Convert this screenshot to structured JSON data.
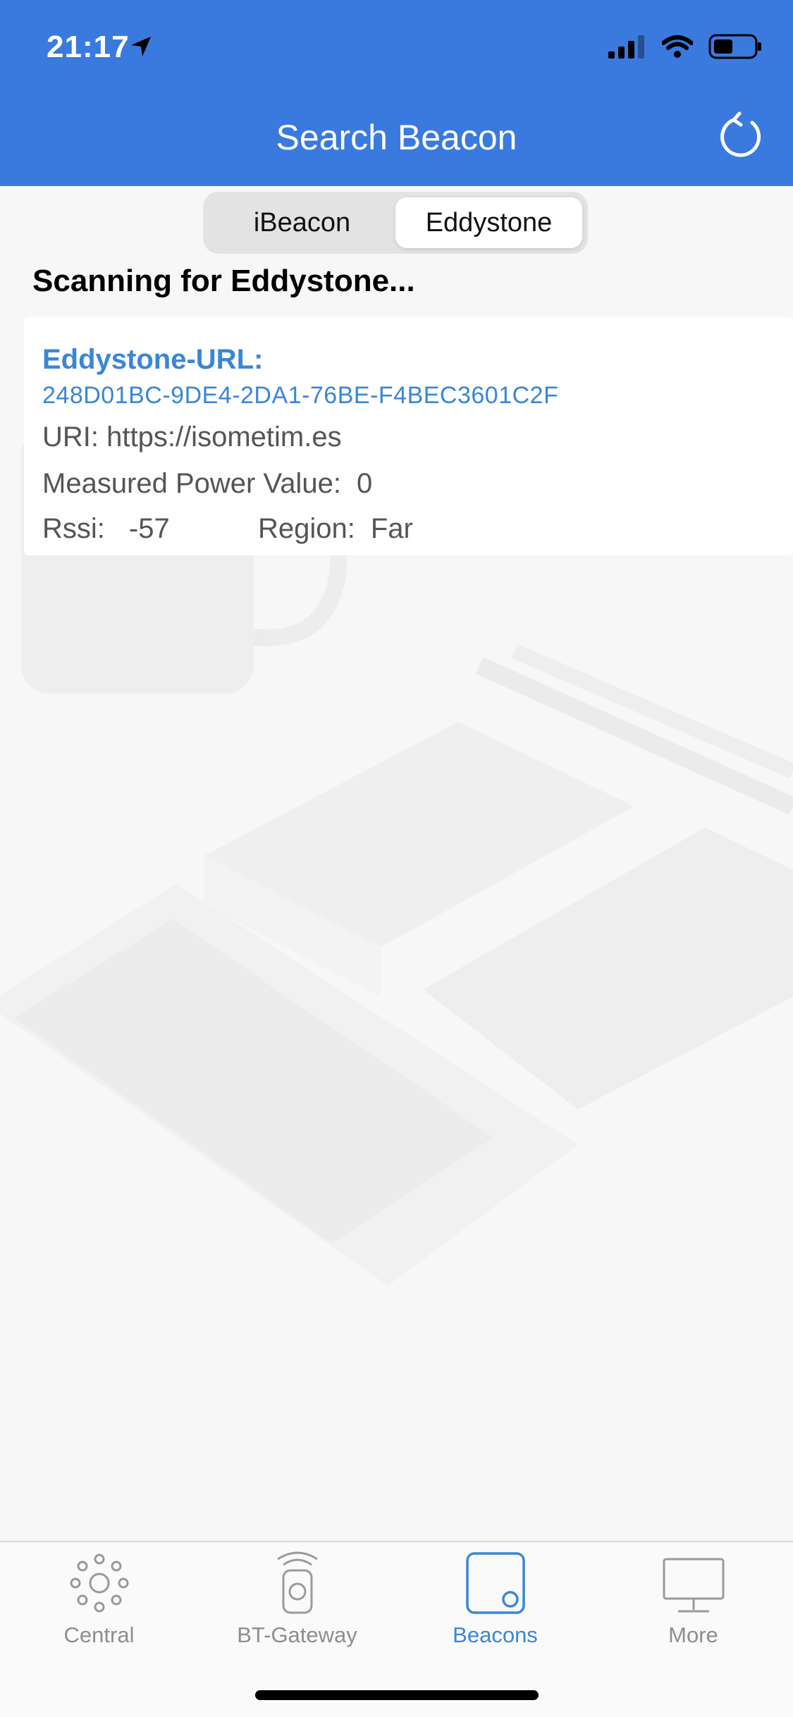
{
  "status_bar": {
    "time": "21:17"
  },
  "nav": {
    "title": "Search Beacon",
    "refresh_icon": "refresh-icon"
  },
  "segments": [
    {
      "label": "iBeacon",
      "active": false
    },
    {
      "label": "Eddystone",
      "active": true
    }
  ],
  "scan_status": "Scanning for Eddystone...",
  "beacon": {
    "type": "Eddystone-URL:",
    "uuid": "248D01BC-9DE4-2DA1-76BE-F4BEC3601C2F",
    "uri_label": "URI:",
    "uri_value": "https://isometim.es",
    "power_label": "Measured Power Value:",
    "power_value": "0",
    "rssi_label": "Rssi:",
    "rssi_value": "-57",
    "region_label": "Region:",
    "region_value": "Far"
  },
  "tabs": [
    {
      "label": "Central",
      "icon": "central-icon",
      "active": false
    },
    {
      "label": "BT-Gateway",
      "icon": "gateway-icon",
      "active": false
    },
    {
      "label": "Beacons",
      "icon": "beacons-icon",
      "active": true
    },
    {
      "label": "More",
      "icon": "monitor-icon",
      "active": false
    }
  ],
  "colors": {
    "header": "#3a7ade",
    "accent": "#3a86d6"
  }
}
